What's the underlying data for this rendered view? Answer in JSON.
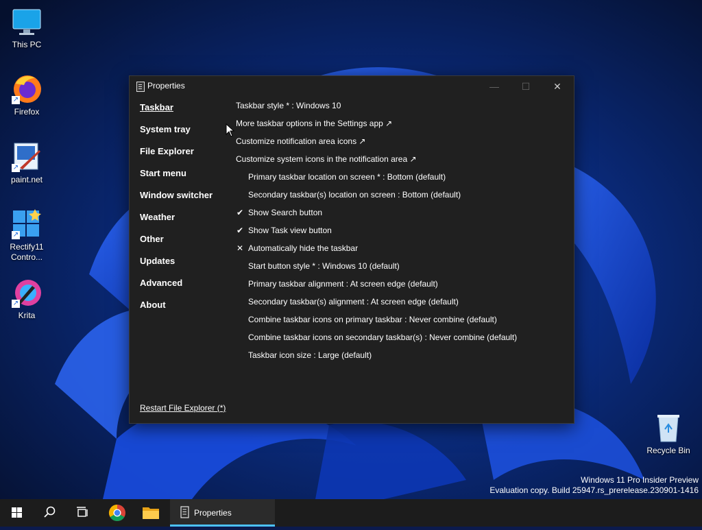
{
  "desktop": {
    "icons": [
      {
        "label": "This PC",
        "icon": "computer-icon"
      },
      {
        "label": "Firefox",
        "icon": "firefox-icon"
      },
      {
        "label": "paint.net",
        "icon": "paintnet-icon"
      },
      {
        "label": "Rectify11 Contro...",
        "icon": "rectify11-icon"
      },
      {
        "label": "Krita",
        "icon": "krita-icon"
      },
      {
        "label": "Recycle Bin",
        "icon": "recycle-bin-icon"
      }
    ],
    "watermark": {
      "line1": "Windows 11 Pro Insider Preview",
      "line2": "Evaluation copy. Build 25947.rs_prerelease.230901-1416"
    }
  },
  "window": {
    "title": "Properties",
    "minimize": "—",
    "maximize": "☐",
    "close": "✕",
    "nav": [
      "Taskbar",
      "System tray",
      "File Explorer",
      "Start menu",
      "Window switcher",
      "Weather",
      "Other",
      "Updates",
      "Advanced",
      "About"
    ],
    "active_nav": "Taskbar",
    "options": [
      {
        "text": "Taskbar style * : Windows 10",
        "mark": ""
      },
      {
        "text": "More taskbar options in the Settings app ↗",
        "mark": ""
      },
      {
        "text": "Customize notification area icons ↗",
        "mark": ""
      },
      {
        "text": "Customize system icons in the notification area ↗",
        "mark": ""
      },
      {
        "text": "Primary taskbar location on screen * : Bottom (default)",
        "mark": ""
      },
      {
        "text": "Secondary taskbar(s) location on screen : Bottom (default)",
        "mark": ""
      },
      {
        "text": "Show Search button",
        "mark": "✔"
      },
      {
        "text": "Show Task view button",
        "mark": "✔"
      },
      {
        "text": "Automatically hide the taskbar",
        "mark": "✕"
      },
      {
        "text": "Start button style * : Windows 10 (default)",
        "mark": ""
      },
      {
        "text": "Primary taskbar alignment : At screen edge (default)",
        "mark": ""
      },
      {
        "text": "Secondary taskbar(s) alignment : At screen edge (default)",
        "mark": ""
      },
      {
        "text": "Combine taskbar icons on primary taskbar : Never combine (default)",
        "mark": ""
      },
      {
        "text": "Combine taskbar icons on secondary taskbar(s) : Never combine (default)",
        "mark": ""
      },
      {
        "text": "Taskbar icon size : Large (default)",
        "mark": ""
      }
    ],
    "restart_link": "Restart File Explorer (*)"
  },
  "taskbar": {
    "buttons": [
      "start-icon",
      "search-icon",
      "task-view-icon",
      "chrome-icon",
      "file-explorer-icon",
      "properties-app-icon"
    ],
    "active_app_label": "Properties",
    "accent": "#4cc2ff"
  }
}
